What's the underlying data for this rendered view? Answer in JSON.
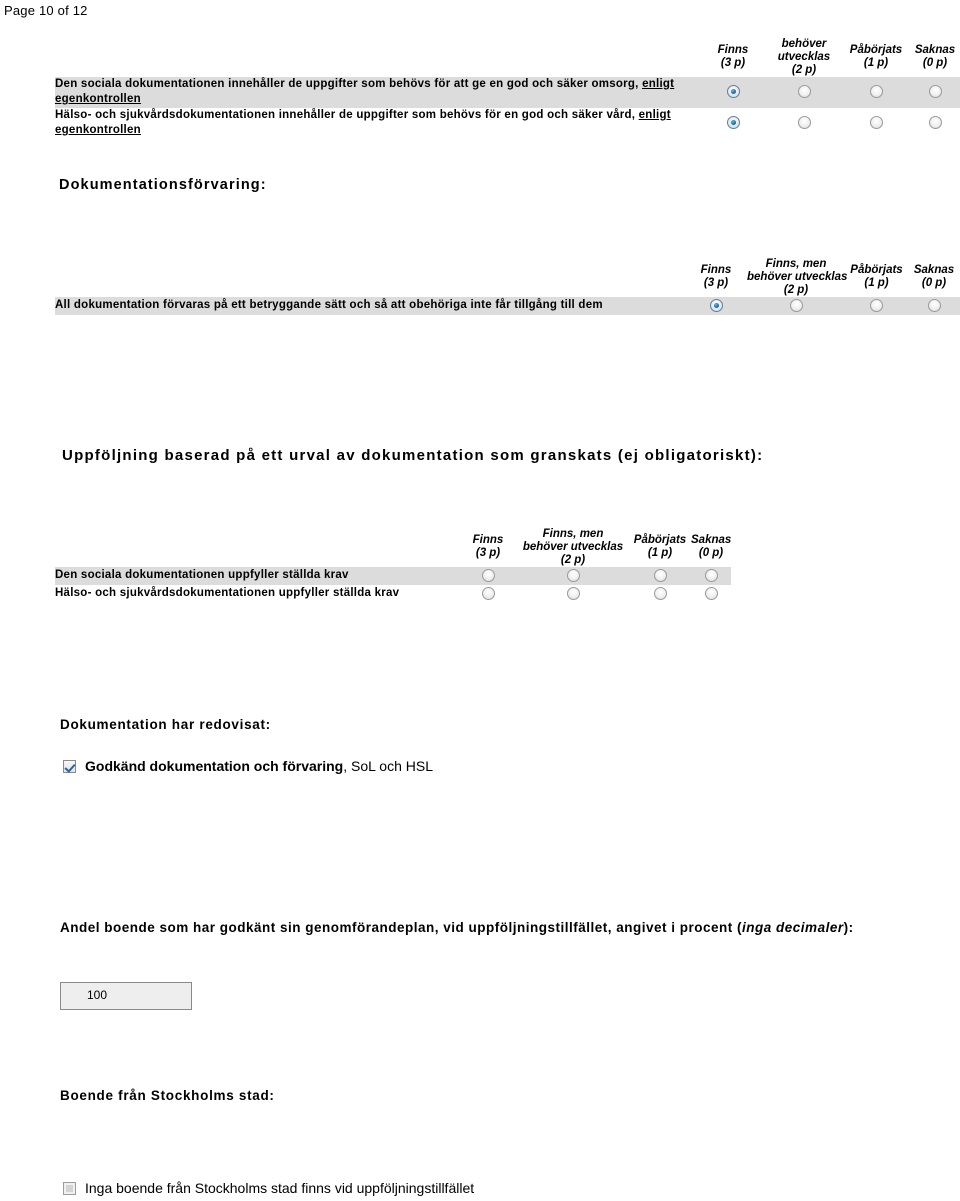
{
  "page": {
    "header": "Page 10 of 12"
  },
  "section1": {
    "columns": [
      {
        "label": "Finns",
        "points": "(3 p)"
      },
      {
        "label": "behöver utvecklas",
        "points": "(2 p)"
      },
      {
        "label": "Påbörjats",
        "points": "(1 p)"
      },
      {
        "label": "Saknas",
        "points": "(0 p)"
      }
    ],
    "rows": [
      {
        "text_part1": "Den sociala dokumentationen innehåller de uppgifter som behövs för att ge en god och säker omsorg, ",
        "text_underlined": "enligt egenkontrollen",
        "selected": 0
      },
      {
        "text_part1": "Hälso- och sjukvårdsdokumentationen innehåller de uppgifter som behövs för en god och säker vård, ",
        "text_underlined": "enligt egenkontrollen",
        "selected": 0
      }
    ]
  },
  "section2": {
    "heading": "Dokumentationsförvaring:",
    "columns": [
      {
        "label": "Finns",
        "points": "(3 p)"
      },
      {
        "label_line1": "Finns, men",
        "label_line2": "behöver utvecklas",
        "points": "(2 p)"
      },
      {
        "label": "Påbörjats",
        "points": "(1 p)"
      },
      {
        "label": "Saknas",
        "points": "(0 p)"
      }
    ],
    "rows": [
      {
        "text": "All dokumentation förvaras på ett betryggande sätt och så att obehöriga inte får tillgång till dem",
        "selected": 0
      }
    ]
  },
  "section3": {
    "heading": "Uppföljning baserad på ett urval av dokumentation som granskats (ej obligatoriskt):",
    "columns": [
      {
        "label": "Finns",
        "points": "(3 p)"
      },
      {
        "label_line1": "Finns, men",
        "label_line2": "behöver utvecklas",
        "points": "(2 p)"
      },
      {
        "label": "Påbörjats",
        "points": "(1 p)"
      },
      {
        "label": "Saknas",
        "points": "(0 p)"
      }
    ],
    "rows": [
      {
        "text": "Den sociala dokumentationen uppfyller ställda krav",
        "selected": -1
      },
      {
        "text": "Hälso- och sjukvårdsdokumentationen uppfyller ställda krav",
        "selected": -1
      }
    ]
  },
  "section4": {
    "heading": "Dokumentation har redovisat:",
    "checkbox": {
      "checked": true,
      "label_bold": "Godkänd dokumentation och förvaring",
      "label_normal": ", SoL och HSL"
    }
  },
  "section5": {
    "question_part1": "Andel boende som har godkänt sin genomförandeplan, vid uppföljningstillfället, angivet i procent (",
    "question_italic": "inga decimaler",
    "question_part2": "):",
    "input_value": "100"
  },
  "section6": {
    "heading": "Boende från Stockholms stad:",
    "checkbox": {
      "checked": false,
      "label": "Inga boende från Stockholms stad finns vid uppföljningstillfället"
    }
  }
}
